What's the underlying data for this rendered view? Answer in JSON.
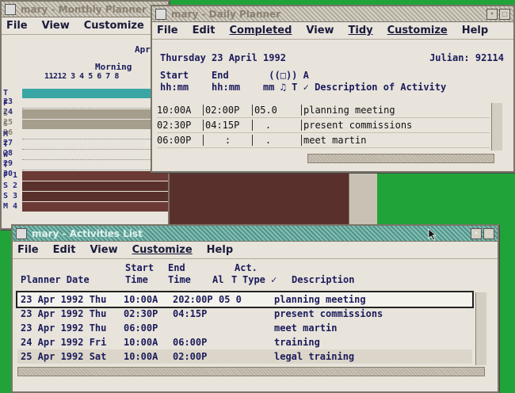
{
  "monthly": {
    "title": "mary - Monthly Planner",
    "menu": [
      "File",
      "View",
      "Customize"
    ],
    "month_label": "Apr",
    "period_label": "Morning",
    "hours_label": "11212 3 4 5 6 7 8",
    "days": [
      {
        "label": "T 23"
      },
      {
        "label": "F 24"
      },
      {
        "label": "S 25"
      },
      {
        "label": "S 26"
      },
      {
        "label": "M 27"
      },
      {
        "label": "T 28"
      },
      {
        "label": "W 29"
      },
      {
        "label": "T 30"
      },
      {
        "label": "F  1"
      },
      {
        "label": "S  2"
      },
      {
        "label": "S  3"
      },
      {
        "label": "M  4"
      }
    ]
  },
  "daily": {
    "title": "mary - Daily Planner",
    "menu": [
      "File",
      "Edit",
      "Completed",
      "View",
      "Tidy",
      "Customize",
      "Help"
    ],
    "date_label": "Thursday 23 April 1992",
    "julian_label": "Julian: 92114",
    "col_headers_line1": "Start    End       ((□)) A",
    "col_headers_line2": "hh:mm    hh:mm    mm ♫ T ✓ Description of Activity",
    "rows": [
      {
        "start": "10:00A",
        "end": "02:00P",
        "mm": "05.0",
        "desc": "planning meeting"
      },
      {
        "start": "02:30P",
        "end": "04:15P",
        "mm": ".",
        "desc": "present commissions"
      },
      {
        "start": "06:00P",
        "end": ":",
        "mm": ".",
        "desc": "meet martin"
      }
    ]
  },
  "activities": {
    "title": "mary - Activities List",
    "menu": [
      "File",
      "Edit",
      "View",
      "Customize",
      "Help"
    ],
    "hdr1_start": "Start",
    "hdr1_end": "End",
    "hdr1_act": "Act.",
    "hdr2_planner": "Planner Date",
    "hdr2_time1": "Time",
    "hdr2_time2": "Time",
    "hdr2_al": "Al",
    "hdr2_t": "T",
    "hdr2_type": "Type ✓",
    "hdr2_desc": "Description",
    "rows": [
      {
        "date": "23 Apr 1992 Thu",
        "start": "10:00A",
        "end": "202:00P",
        "type": "05 0",
        "desc": "planning meeting"
      },
      {
        "date": "23 Apr 1992 Thu",
        "start": "02:30P",
        "end": "04:15P",
        "type": "",
        "desc": "present commissions"
      },
      {
        "date": "23 Apr 1992 Thu",
        "start": "06:00P",
        "end": "",
        "type": "",
        "desc": "meet martin"
      },
      {
        "date": "24 Apr 1992 Fri",
        "start": "10:00A",
        "end": "06:00P",
        "type": "",
        "desc": "training"
      },
      {
        "date": "25 Apr 1992 Sat",
        "start": "10:00A",
        "end": "02:00P",
        "type": "",
        "desc": "legal training"
      }
    ]
  },
  "colors": {
    "desktop": "#20a43a",
    "active_title": "#5ba99c",
    "today_row": "#3aa6a4",
    "weekend_row": "#a69e8c",
    "dark_band": "#6b3a34"
  }
}
